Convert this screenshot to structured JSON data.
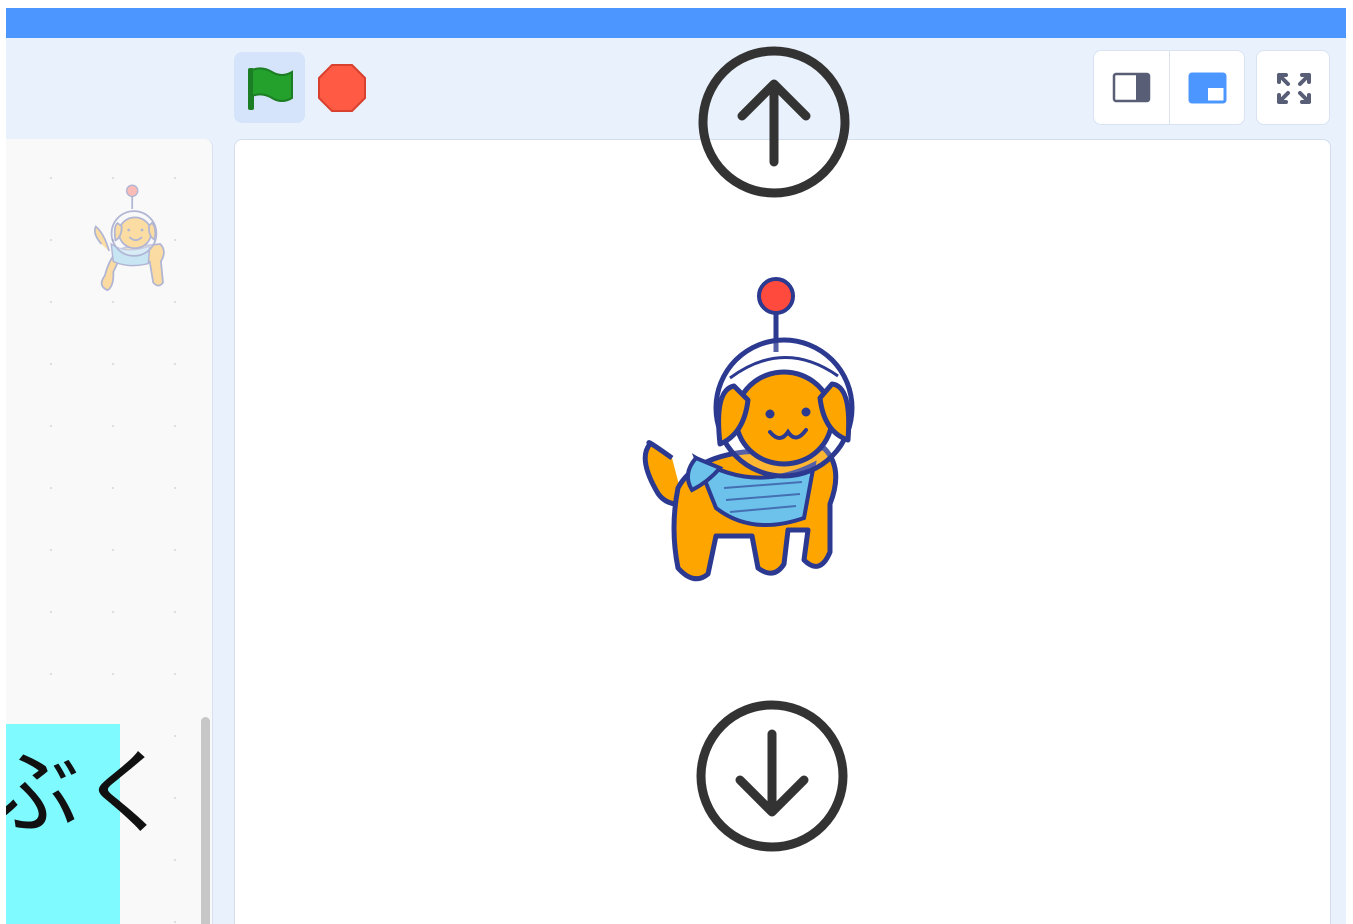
{
  "colors": {
    "menu_bar": "#4c97ff",
    "app_background": "#e9f1fc",
    "green_flag": "#24a02c",
    "stop": "#ff5a44",
    "selected_control": "#d5e4fa",
    "card_background": "#7ffbff"
  },
  "toolbar": {
    "green_flag_icon": "green-flag-icon",
    "stop_icon": "stop-sign-icon",
    "layout_small_icon": "small-stage-icon",
    "layout_normal_icon": "normal-stage-icon",
    "fullscreen_icon": "fullscreen-icon"
  },
  "overlay": {
    "up_arrow_icon": "up-arrow-circle-icon",
    "down_arrow_icon": "down-arrow-circle-icon"
  },
  "stage": {
    "sprite": "space-dog-sprite"
  },
  "code_area": {
    "ghost_sprite": "space-dog-sprite-thumbnail",
    "card_text": "ぶく"
  }
}
